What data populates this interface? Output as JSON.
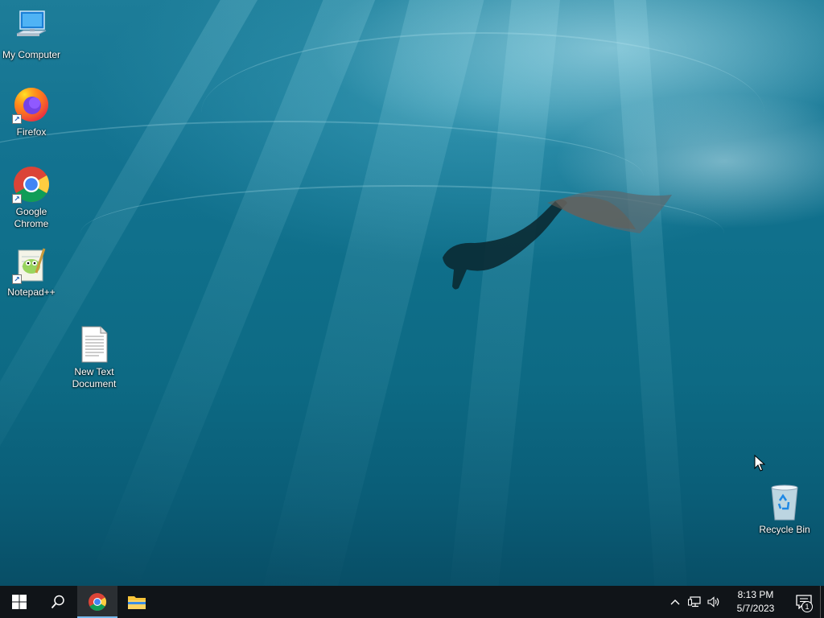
{
  "desktop": {
    "icons": [
      {
        "label": "My Computer",
        "icon": "computer-icon"
      },
      {
        "label": "Firefox",
        "icon": "firefox-icon"
      },
      {
        "label": "Google Chrome",
        "icon": "chrome-icon"
      },
      {
        "label": "Notepad++",
        "icon": "notepadpp-icon"
      },
      {
        "label": "New Text Document",
        "icon": "text-document-icon"
      },
      {
        "label": "Recycle Bin",
        "icon": "recycle-bin-icon"
      }
    ]
  },
  "taskbar": {
    "start_icon": "windows-start-icon",
    "search_icon": "search-icon",
    "apps": [
      {
        "name": "Google Chrome",
        "icon": "chrome-icon",
        "state": "active"
      },
      {
        "name": "File Explorer",
        "icon": "folder-icon",
        "state": "pinned"
      }
    ],
    "tray": {
      "time": "8:13 PM",
      "date": "5/7/2023",
      "notification_count": "1"
    }
  },
  "colors": {
    "taskbar_bg": "#101418",
    "accent": "#76b9ed"
  }
}
